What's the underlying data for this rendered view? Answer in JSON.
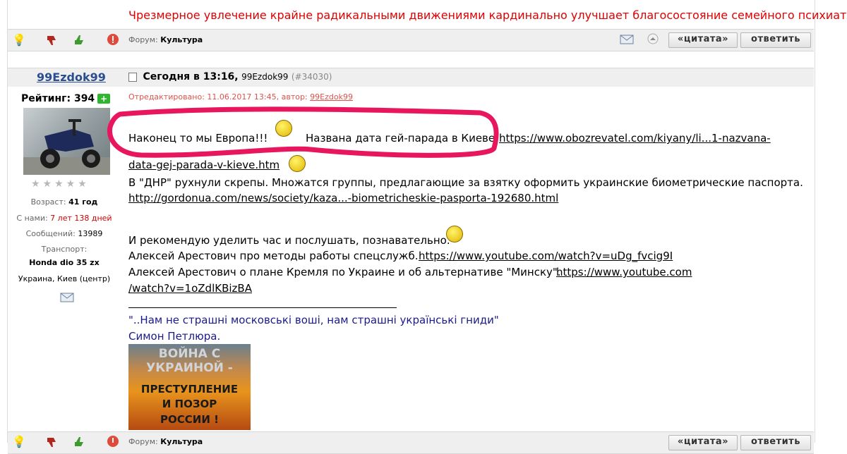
{
  "top_post": {
    "signature": "Чрезмерное увлечение крайне радикальными движениями кардинально улучшает благосостояние семейного психиатра!",
    "forum_label": "Форум:",
    "forum_name": "Культура",
    "quote_btn": "«цитата»",
    "reply_btn": "ответить"
  },
  "post": {
    "username": "99Ezdok99",
    "date": "Сегодня в 13:16,",
    "author_small": "99Ezdok99",
    "post_num": "(#34030)",
    "edited_prefix": "Отредактировано: 11.06.2017 13:45, автор:",
    "edited_author": "99Ezdok99"
  },
  "user": {
    "rating_label": "Рейтинг: 394",
    "plus": "+",
    "stars": "★★★★★",
    "age_label": "Возраст:",
    "age_value": "41 год",
    "with_us_label": "С нами:",
    "with_us_value": "7 лет 138 дней",
    "messages_label": "Сообщений:",
    "messages_value": "13989",
    "transport_label": "Транспорт:",
    "transport_value": "Honda dio 35 zx",
    "location": "Украина, Киев (центр)"
  },
  "content": {
    "line1_a": "Наконец то мы Европа!!!",
    "line1_b": "Названа дата гей-парада в Киеве",
    "link1_a": "https://www.obozrevatel.com/kiyany/li...1-nazvana-",
    "link1_b": "data-gej-parada-v-kieve.htm",
    "line2": "В \"ДНР\" рухнули скрепы. Множатся группы, предлагающие за взятку оформить украинские биометрические паспорта.",
    "link2": "http://gordonua.com/news/society/kaza...-biometricheskie-pasporta-192680.html",
    "line3": "И рекомендую уделить час и послушать, познавательно.",
    "line4": "Алексей Арестович про методы работы спецслужб.",
    "link4": "https://www.youtube.com/watch?v=uDg_fvcig9I",
    "line5": "Алексей Арестович о плане Кремля по Украине и об альтернативе \"Минску\".",
    "link5_a": "https://www.youtube.com",
    "link5_b": "/watch?v=1oZdlKBizBA",
    "quote": "\"..Нам не страшні московські воші, нам страшні українські гниди\"",
    "quote_author": "Симон Петлюра."
  },
  "banner": {
    "line1": "ВОЙНА С",
    "line2": "УКРАИНОЙ -",
    "line3": "ПРЕСТУПЛЕНИЕ",
    "line4": "И ПОЗОР",
    "line5": "РОССИИ !"
  },
  "bottom_bar": {
    "forum_label": "Форум:",
    "forum_name": "Культура",
    "quote_btn": "«цитата»",
    "reply_btn": "ответить"
  },
  "colors": {
    "signature": "#e00000",
    "username": "#2a4e8f",
    "annotation": "#e8165e",
    "edited": "#e0504a",
    "quote": "#1a1a8c"
  }
}
